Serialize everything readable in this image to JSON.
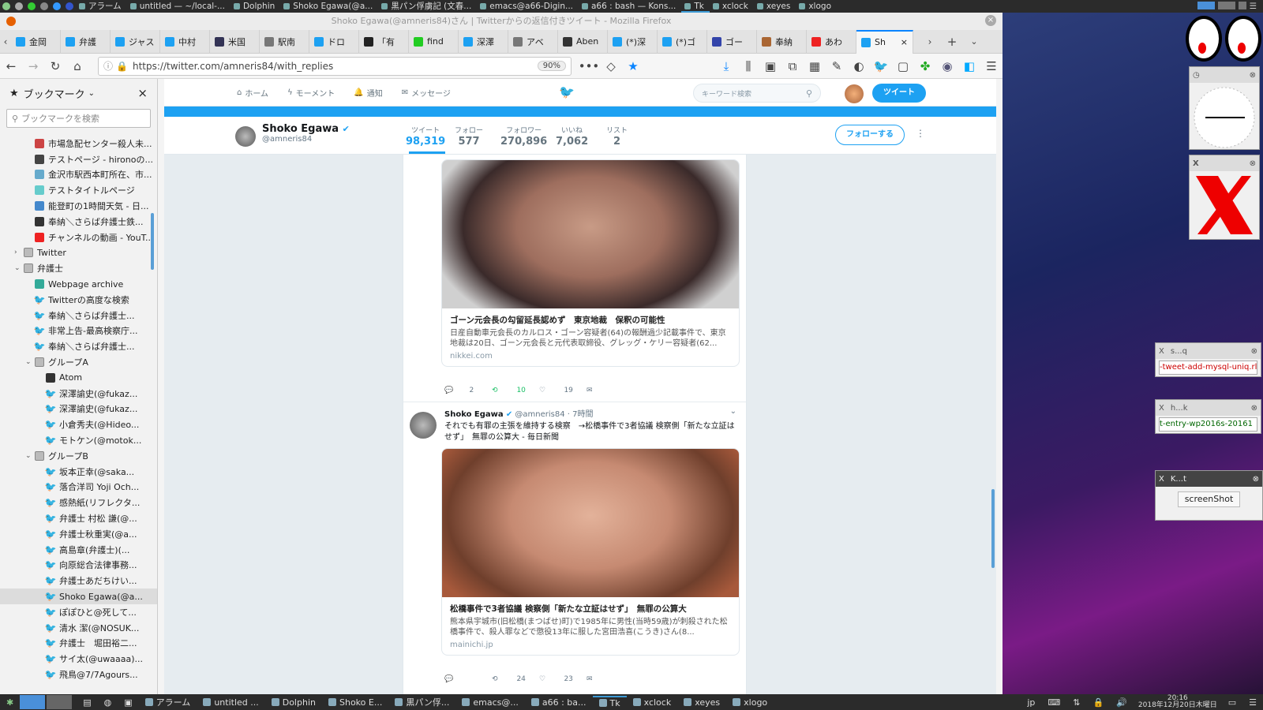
{
  "taskbar_top": {
    "items": [
      {
        "label": "アラーム",
        "active": false
      },
      {
        "label": "untitled — ~/local-...",
        "active": false
      },
      {
        "label": "Dolphin",
        "active": false
      },
      {
        "label": "Shoko Egawa(@a...",
        "active": false
      },
      {
        "label": "黒パン俘虜記 (文春...",
        "active": false
      },
      {
        "label": "emacs@a66-Digin...",
        "active": false
      },
      {
        "label": "a66 : bash — Kons...",
        "active": false
      },
      {
        "label": "Tk",
        "active": true
      },
      {
        "label": "xclock",
        "active": false
      },
      {
        "label": "xeyes",
        "active": false
      },
      {
        "label": "xlogo",
        "active": false
      }
    ]
  },
  "window": {
    "title": "Shoko Egawa(@amneris84)さん | Twitterからの返信付きツイート - Mozilla Firefox"
  },
  "tabs": [
    "金岡",
    "弁護",
    "ジャス",
    "中村",
    "米国",
    "駅南",
    "ドロ",
    "「有",
    "find",
    "深澤",
    "アベ",
    "Aben",
    "(*)深",
    "(*)ゴ",
    "ゴー",
    "奉納",
    "あわ",
    "Sh"
  ],
  "url": "https://twitter.com/amneris84/with_replies",
  "zoom": "90%",
  "sidebar": {
    "title": "ブックマーク",
    "search_placeholder": "ブックマークを検索",
    "items": [
      {
        "label": "市場急配センター殺人未...",
        "indent": 1
      },
      {
        "label": "テストページ - hironoの...",
        "indent": 1
      },
      {
        "label": "金沢市駅西本町所在、市...",
        "indent": 1
      },
      {
        "label": "テストタイトルページ",
        "indent": 1
      },
      {
        "label": "能登町の1時間天気 - 日...",
        "indent": 1
      },
      {
        "label": "奉納＼さらば弁護士鉄...",
        "indent": 1
      },
      {
        "label": "チャンネルの動画 - YouT...",
        "indent": 1
      },
      {
        "label": "Twitter",
        "indent": 0
      },
      {
        "label": "弁護士",
        "indent": 0
      },
      {
        "label": "Webpage archive",
        "indent": 1
      },
      {
        "label": "Twitterの高度な検索",
        "indent": 1
      },
      {
        "label": "奉納＼さらば弁護士...",
        "indent": 1
      },
      {
        "label": "非常上告-最高検察庁...",
        "indent": 1
      },
      {
        "label": "奉納＼さらば弁護士...",
        "indent": 1
      },
      {
        "label": "グループA",
        "indent": 1
      },
      {
        "label": "Atom",
        "indent": 2
      },
      {
        "label": "深澤諭史(@fukaz...",
        "indent": 2
      },
      {
        "label": "深澤諭史(@fukaz...",
        "indent": 2
      },
      {
        "label": "小倉秀夫(@Hideo...",
        "indent": 2
      },
      {
        "label": "モトケン(@motok...",
        "indent": 2
      },
      {
        "label": "グループB",
        "indent": 1
      },
      {
        "label": "坂本正幸(@saka...",
        "indent": 2
      },
      {
        "label": "落合洋司 Yoji Och...",
        "indent": 2
      },
      {
        "label": "感熱紙(リフレクタ...",
        "indent": 2
      },
      {
        "label": "弁護士 村松 謙(@...",
        "indent": 2
      },
      {
        "label": "弁護士秋重実(@a...",
        "indent": 2
      },
      {
        "label": "高島章(弁護士)(...",
        "indent": 2
      },
      {
        "label": "向原総合法律事務...",
        "indent": 2
      },
      {
        "label": "弁護士あだちけい...",
        "indent": 2
      },
      {
        "label": "Shoko Egawa(@a...",
        "indent": 2,
        "selected": true
      },
      {
        "label": "ぽぽひと@死して...",
        "indent": 2
      },
      {
        "label": "清水 潔(@NOSUK...",
        "indent": 2
      },
      {
        "label": "弁護士　堀田裕二...",
        "indent": 2
      },
      {
        "label": "サイ太(@uwaaaa)...",
        "indent": 2
      },
      {
        "label": "飛鳥@7/7Agours...",
        "indent": 2
      }
    ]
  },
  "twitter": {
    "nav": {
      "home": "ホーム",
      "moments": "モーメント",
      "notifications": "通知",
      "messages": "メッセージ",
      "search_placeholder": "キーワード検索",
      "tweet_btn": "ツイート"
    },
    "profile": {
      "name": "Shoko Egawa",
      "handle": "@amneris84",
      "follow_btn": "フォローする",
      "stats": [
        {
          "label": "ツイート",
          "value": "98,319"
        },
        {
          "label": "フォロー",
          "value": "577"
        },
        {
          "label": "フォロワー",
          "value": "270,896"
        },
        {
          "label": "いいね",
          "value": "7,062"
        },
        {
          "label": "リスト",
          "value": "2"
        }
      ]
    },
    "tweets": [
      {
        "card_title": "ゴーン元会長の勾留延長認めず　東京地裁　保釈の可能性",
        "card_desc": "日産自動車元会長のカルロス・ゴーン容疑者(64)の報酬過少記載事件で、東京地裁は20日、ゴーン元会長と元代表取締役、グレッグ・ケリー容疑者(62...",
        "card_url": "nikkei.com",
        "replies": "2",
        "retweets": "10",
        "likes": "19"
      },
      {
        "author": "Shoko Egawa",
        "handle": "@amneris84 · 7時間",
        "text": "それでも有罪の主張を維持する検察　→松橋事件で3者協議 検察側「新たな立証はせず」　無罪の公算大 - 毎日新聞",
        "card_title": "松橋事件で3者協議 検察側「新たな立証はせず」　無罪の公算大",
        "card_desc": "熊本県宇城市(旧松橋(まつばせ)町)で1985年に男性(当時59歳)が刺殺された松橋事件で、殺人罪などで懲役13年に服した宮田浩喜(こうき)さん(8...",
        "card_url": "mainichi.jp",
        "replies": "",
        "retweets": "24",
        "likes": "23"
      }
    ]
  },
  "desktop": {
    "mini1": "s...q",
    "mini1_value": "-tweet-add-mysql-uniq.rl",
    "mini2": "h...k",
    "mini2_value": "t-entry-wp2016s-20161",
    "mini3": "K...t",
    "mini3_btn": "screenShot"
  },
  "taskbar_bottom": {
    "items": [
      "アラーム",
      "untitled ...",
      "Dolphin",
      "Shoko E...",
      "黒パン俘...",
      "emacs@...",
      "a66 : ba...",
      "Tk",
      "xclock",
      "xeyes",
      "xlogo"
    ],
    "lang": "jp",
    "clock_time": "20:16",
    "clock_date": "2018年12月20日木曜日"
  }
}
